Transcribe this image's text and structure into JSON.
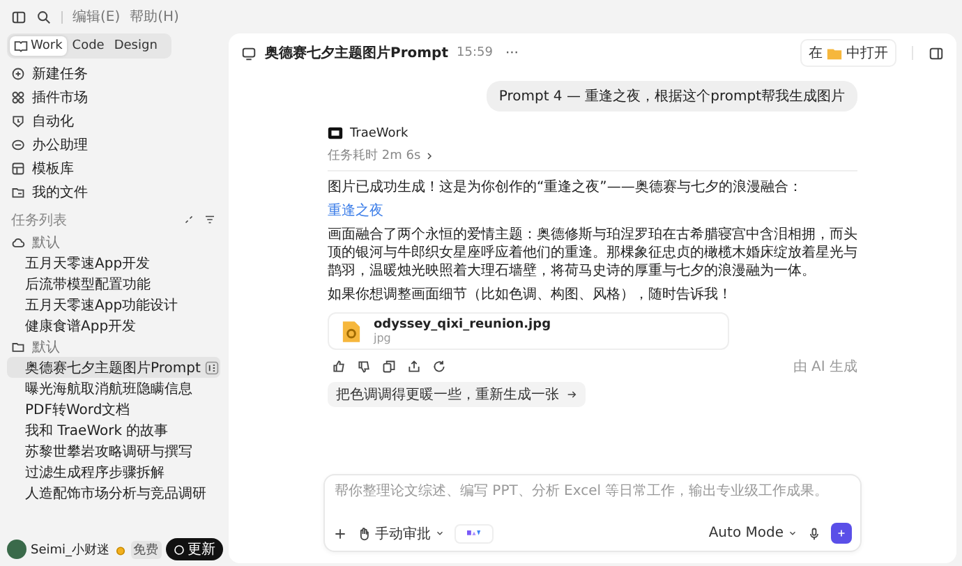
{
  "menu": {
    "items": [
      "编辑(E)",
      "帮助(H)"
    ]
  },
  "mode_tabs": [
    {
      "label": "Work",
      "selected": true
    },
    {
      "label": "Code",
      "selected": false
    },
    {
      "label": "Design",
      "selected": false
    }
  ],
  "nav": [
    "新建任务",
    "插件市场",
    "自动化",
    "办公助理",
    "模板库",
    "我的文件"
  ],
  "task_list": {
    "title": "任务列表",
    "groups": [
      {
        "name": "默认",
        "kind": "cloud",
        "items": [
          {
            "label": "五月天零速App开发",
            "selected": false
          },
          {
            "label": "后流带模型配置功能",
            "selected": false
          },
          {
            "label": "五月天零速App功能设计",
            "selected": false
          },
          {
            "label": "健康食谱App开发",
            "selected": false
          }
        ]
      },
      {
        "name": "默认",
        "kind": "folder",
        "items": [
          {
            "label": "奥德赛七夕主题图片Prompt",
            "selected": true
          },
          {
            "label": "曝光海航取消航班隐瞒信息",
            "selected": false
          },
          {
            "label": "PDF转Word文档",
            "selected": false
          },
          {
            "label": "我和 TraeWork 的故事",
            "selected": false
          },
          {
            "label": "苏黎世攀岩攻略调研与撰写",
            "selected": false
          },
          {
            "label": "过滤生成程序步骤拆解",
            "selected": false
          },
          {
            "label": "人造配饰市场分析与竞品调研",
            "selected": false
          }
        ]
      }
    ]
  },
  "user": {
    "name": "Seimi_小财迷",
    "plan": "免费",
    "button": "更新"
  },
  "chat": {
    "title": "奥德赛七夕主题图片Prompt",
    "time": "15:59",
    "more": "···",
    "open_prefix": "在",
    "open_suffix": "中打开"
  },
  "user_message": "Prompt 4 — 重逢之夜，根据这个prompt帮我生成图片",
  "assistant": {
    "name": "TraeWork",
    "duration": "任务耗时 2m 6s",
    "blocks": [
      {
        "kind": "text",
        "text": "图片已成功生成！这是为你创作的“重逢之夜”——奥德赛与七夕的浪漫融合："
      },
      {
        "kind": "link",
        "text": "重逢之夜"
      },
      {
        "kind": "text",
        "text": "画面融合了两个永恒的爱情主题：奥德修斯与珀涅罗珀在古希腊寝宫中含泪相拥，而头顶的银河与牛郎织女星座呼应着他们的重逢。那棵象征忠贞的橄榄木婚床绽放着星光与鹊羽，温暖烛光映照着大理石墙壁，将荷马史诗的厚重与七夕的浪漫融为一体。"
      },
      {
        "kind": "text",
        "text": "如果你想调整画面细节（比如色调、构图、风格），随时告诉我！"
      }
    ],
    "attachment": {
      "name": "odyssey_qixi_reunion.jpg",
      "type": "jpg"
    },
    "ai_note": "由 AI 生成"
  },
  "suggestion": "把色调调得更暖一些，重新生成一张",
  "composer": {
    "placeholder": "帮你整理论文综述、编写 PPT、分析 Excel 等日常工作，输出专业级工作成果。",
    "approval": "手动审批",
    "mode": "Auto Mode"
  }
}
